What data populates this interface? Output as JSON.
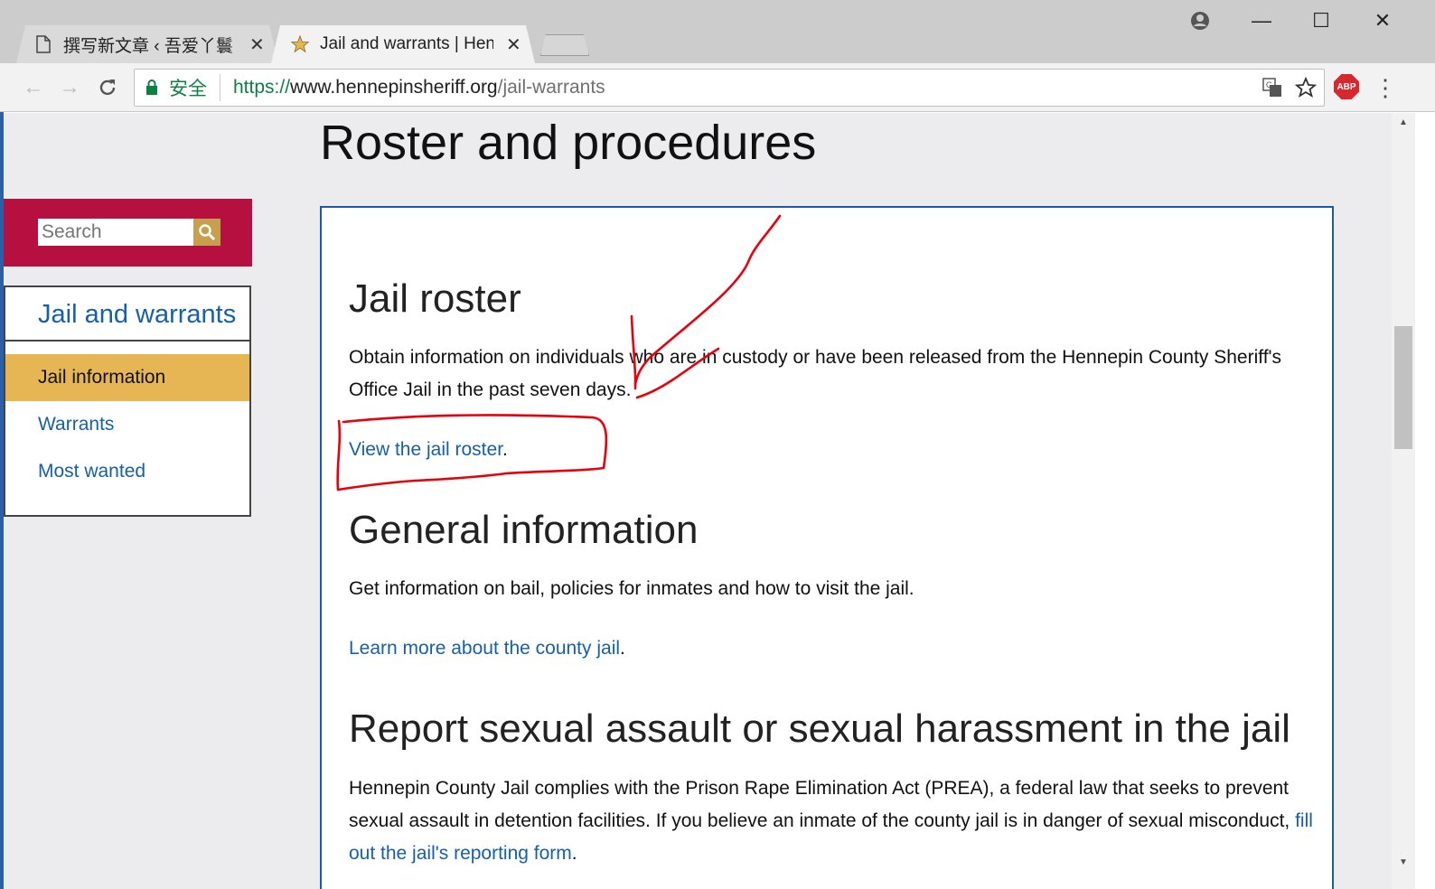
{
  "browser": {
    "tabs": [
      {
        "title": "撰写新文章 ‹ 吾爱丫鬟 —",
        "icon": "document-icon",
        "active": false
      },
      {
        "title": "Jail and warrants | Henn",
        "icon": "star-favicon-icon",
        "active": true
      }
    ],
    "close_tab_glyph": "✕",
    "window_controls": {
      "minimize": "—",
      "maximize": "☐",
      "close": "✕"
    },
    "security_label": "安全",
    "url": {
      "scheme": "https://",
      "host": "www.hennepinsheriff.org",
      "path": "/jail-warrants"
    },
    "abp_label": "ABP",
    "menu_glyph": "⋮"
  },
  "page": {
    "title": "Roster and procedures",
    "search": {
      "placeholder": "Search"
    },
    "sidenav": {
      "heading": "Jail and warrants",
      "items": [
        {
          "label": "Jail information",
          "active": true
        },
        {
          "label": "Warrants",
          "active": false
        },
        {
          "label": "Most wanted",
          "active": false
        }
      ]
    },
    "sections": [
      {
        "heading": "Jail roster",
        "body": "Obtain information on individuals who are in custody or have been released from the Hennepin County Sheriff's Office Jail in the past seven days.",
        "link": "View the jail roster",
        "link_suffix": "."
      },
      {
        "heading": "General information",
        "body": "Get information on bail, policies for inmates and how to visit the jail.",
        "link": "Learn more about the county jail",
        "link_suffix": "."
      },
      {
        "heading": "Report sexual assault or sexual harassment in the jail",
        "body": "Hennepin County Jail complies with the Prison Rape Elimination Act (PREA), a federal law that seeks to prevent sexual assault in detention facilities. If you believe an inmate of the county jail is in danger of sexual misconduct, ",
        "link": "fill out the jail's reporting form",
        "link_suffix": "."
      }
    ]
  },
  "colors": {
    "brand_red": "#b5103f",
    "active_gold": "#e5b653",
    "link_blue": "#1560a8",
    "box_border": "#1b5aa6",
    "annotation_red": "#e8000a",
    "secure_green": "#0b8043"
  }
}
